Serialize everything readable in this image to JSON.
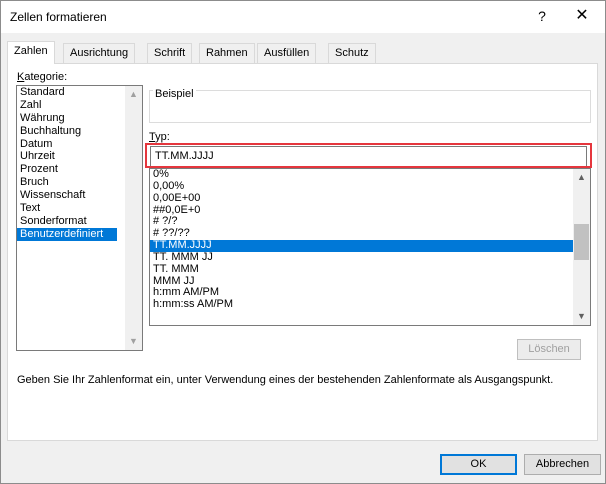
{
  "window": {
    "title": "Zellen formatieren",
    "help": "?",
    "close": "✕"
  },
  "tabs": [
    {
      "label": "Zahlen",
      "active": true
    },
    {
      "label": "Ausrichtung"
    },
    {
      "label": "Schrift"
    },
    {
      "label": "Rahmen"
    },
    {
      "label": "Ausfüllen"
    },
    {
      "label": "Schutz"
    }
  ],
  "kategorie": {
    "label_first": "K",
    "label_rest": "ategorie:",
    "items": [
      "Standard",
      "Zahl",
      "Währung",
      "Buchhaltung",
      "Datum",
      "Uhrzeit",
      "Prozent",
      "Bruch",
      "Wissenschaft",
      "Text",
      "Sonderformat",
      "Benutzerdefiniert"
    ],
    "selected": "Benutzerdefiniert"
  },
  "beispiel": {
    "label": "Beispiel"
  },
  "typ": {
    "label_first": "T",
    "label_rest": "yp:",
    "value": "TT.MM.JJJJ",
    "highlight_color": "#e5363d"
  },
  "formats": {
    "items": [
      "0%",
      "0,00%",
      "0,00E+00",
      "##0,0E+0",
      "# ?/?",
      "# ??/??",
      "TT.MM.JJJJ",
      "TT. MMM JJ",
      "TT. MMM",
      "MMM JJ",
      "h:mm AM/PM",
      "h:mm:ss AM/PM"
    ],
    "selected": "TT.MM.JJJJ"
  },
  "buttons": {
    "delete": "Löschen",
    "ok": "OK",
    "cancel": "Abbrechen"
  },
  "hint": "Geben Sie Ihr Zahlenformat ein, unter Verwendung eines der bestehenden Zahlenformate als Ausgangspunkt.",
  "colors": {
    "selection": "#0078d7",
    "ok_border": "#0078d7"
  }
}
